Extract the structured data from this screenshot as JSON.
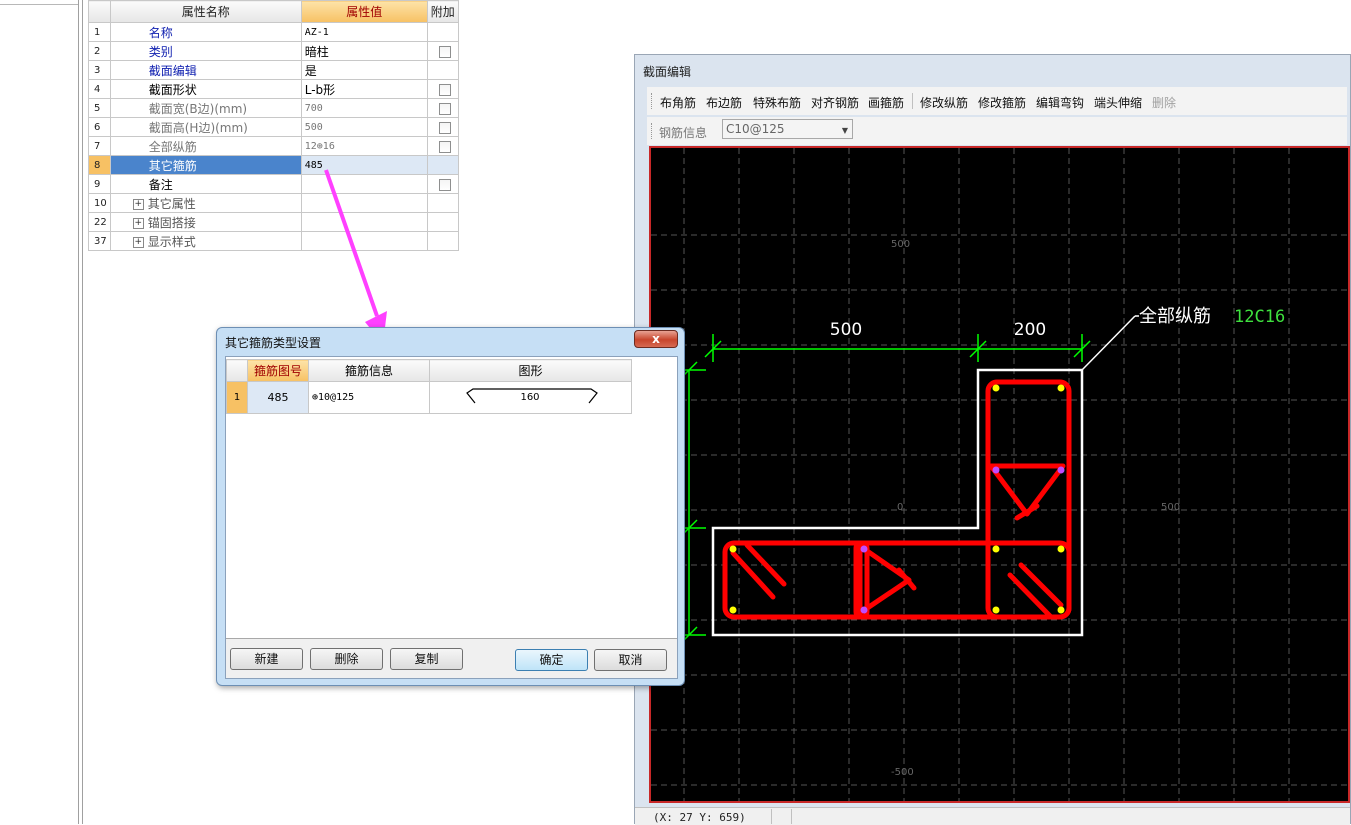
{
  "property_grid": {
    "headers": {
      "name": "属性名称",
      "value": "属性值",
      "extra": "附加"
    },
    "rows": [
      {
        "num": "1",
        "name": "名称",
        "value": "AZ-1",
        "checkbox": false,
        "style": "blue"
      },
      {
        "num": "2",
        "name": "类别",
        "value": "暗柱",
        "checkbox": true,
        "style": "blue"
      },
      {
        "num": "3",
        "name": "截面编辑",
        "value": "是",
        "checkbox": false,
        "style": "blue"
      },
      {
        "num": "4",
        "name": "截面形状",
        "value": "L-b形",
        "checkbox": true,
        "style": "black"
      },
      {
        "num": "5",
        "name": "截面宽(B边)(mm)",
        "value": "700",
        "checkbox": true,
        "style": "gray"
      },
      {
        "num": "6",
        "name": "截面高(H边)(mm)",
        "value": "500",
        "checkbox": true,
        "style": "gray"
      },
      {
        "num": "7",
        "name": "全部纵筋",
        "value": "12⊕16",
        "checkbox": true,
        "style": "gray"
      },
      {
        "num": "8",
        "name": "其它箍筋",
        "value": "485",
        "checkbox": false,
        "style": "selected"
      },
      {
        "num": "9",
        "name": "备注",
        "value": "",
        "checkbox": true,
        "style": "black"
      }
    ],
    "groups": [
      {
        "num": "10",
        "name": "其它属性",
        "expander": "+"
      },
      {
        "num": "22",
        "name": "锚固搭接",
        "expander": "+"
      },
      {
        "num": "37",
        "name": "显示样式",
        "expander": "+"
      }
    ]
  },
  "section_editor": {
    "title": "截面编辑",
    "toolbar": [
      "布角筋",
      "布边筋",
      "特殊布筋",
      "对齐钢筋",
      "画箍筋",
      "修改纵筋",
      "修改箍筋",
      "编辑弯钩",
      "端头伸缩",
      "删除"
    ],
    "rebar_info_label": "钢筋信息",
    "rebar_info_value": "C10@125",
    "canvas": {
      "dim_width_left": "500",
      "dim_width_right": "200",
      "axis_top": "500",
      "axis_center": "0",
      "axis_right": "500",
      "axis_bottom": "-500",
      "annotation_label": "全部纵筋",
      "annotation_value": "12C16",
      "colors": {
        "background": "#000000",
        "stirrup": "#ff0000",
        "outline": "#ffffff",
        "dimension": "#00ff00",
        "annotation_value": "#3ee03e",
        "corner_bar": "#ffff00",
        "side_bar": "#c04cff"
      }
    },
    "status_coords": "(X: 27 Y: 659)"
  },
  "dialog": {
    "title": "其它箍筋类型设置",
    "close_label": "x",
    "headers": {
      "code": "箍筋图号",
      "info": "箍筋信息",
      "shape": "图形"
    },
    "rows": [
      {
        "num": "1",
        "code": "485",
        "info": "⊕10@125",
        "shape_value": "160"
      }
    ],
    "buttons": {
      "new": "新建",
      "delete": "删除",
      "copy": "复制",
      "ok": "确定",
      "cancel": "取消"
    }
  },
  "arrow_color": "#ff40ff"
}
